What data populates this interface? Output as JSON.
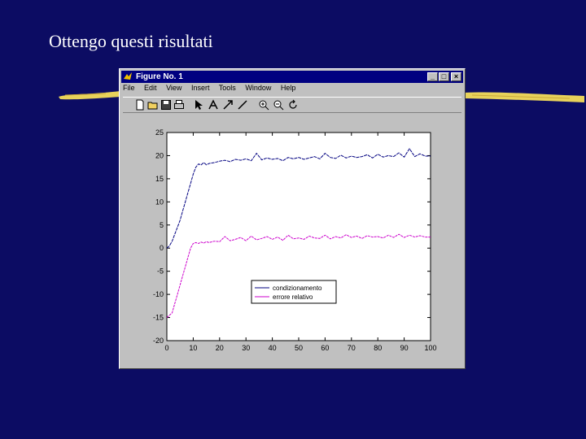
{
  "slide": {
    "title": "Ottengo questi risultati"
  },
  "window": {
    "title": "Figure No. 1",
    "controls": {
      "minimize": "_",
      "maximize": "□",
      "close": "×"
    },
    "menu": [
      "File",
      "Edit",
      "View",
      "Insert",
      "Tools",
      "Window",
      "Help"
    ],
    "tools": [
      "new-file-icon",
      "open-folder-icon",
      "save-icon",
      "print-icon",
      "pointer-icon",
      "text-tool-icon",
      "arrow-tool-icon",
      "line-tool-icon",
      "zoom-in-icon",
      "zoom-out-icon",
      "rotate-icon"
    ]
  },
  "chart_data": {
    "type": "line",
    "xlim": [
      0,
      100
    ],
    "ylim": [
      -20,
      25
    ],
    "x_ticks": [
      0,
      10,
      20,
      30,
      40,
      50,
      60,
      70,
      80,
      90,
      100
    ],
    "y_ticks": [
      25,
      20,
      15,
      10,
      5,
      0,
      -5,
      -10,
      -15,
      -20
    ],
    "legend_position": "center-right",
    "series": [
      {
        "name": "condizionamento",
        "color": "#000080",
        "dash": "solid",
        "x": [
          0,
          1,
          2,
          3,
          4,
          5,
          6,
          7,
          8,
          9,
          10,
          11,
          12,
          13,
          14,
          15,
          16,
          18,
          20,
          22,
          24,
          26,
          28,
          30,
          32,
          34,
          36,
          38,
          40,
          42,
          44,
          46,
          48,
          50,
          52,
          54,
          56,
          58,
          60,
          62,
          64,
          66,
          68,
          70,
          72,
          74,
          76,
          78,
          80,
          82,
          84,
          86,
          88,
          90,
          92,
          94,
          96,
          98,
          100
        ],
        "y": [
          0,
          0.5,
          1.5,
          3,
          4.5,
          6,
          8,
          10,
          12,
          14,
          16,
          17.5,
          18.2,
          18,
          18.5,
          18,
          18.3,
          18.5,
          18.8,
          19,
          18.7,
          19.2,
          19,
          19.3,
          18.9,
          20.5,
          19.1,
          19.5,
          19.2,
          19.4,
          18.9,
          19.6,
          19.3,
          19.6,
          19.2,
          19.5,
          19.8,
          19.3,
          20.5,
          19.6,
          19.4,
          20.1,
          19.5,
          19.9,
          19.6,
          19.8,
          20.2,
          19.5,
          20.3,
          19.7,
          20,
          19.8,
          20.6,
          19.7,
          21.5,
          19.8,
          20.4,
          19.9,
          19.9
        ]
      },
      {
        "name": "errore relativo",
        "color": "#cc00cc",
        "dash": "solid",
        "x": [
          0,
          1,
          2,
          3,
          4,
          5,
          6,
          7,
          8,
          9,
          10,
          11,
          12,
          13,
          14,
          15,
          16,
          18,
          20,
          22,
          24,
          26,
          28,
          30,
          32,
          34,
          36,
          38,
          40,
          42,
          44,
          46,
          48,
          50,
          52,
          54,
          56,
          58,
          60,
          62,
          64,
          66,
          68,
          70,
          72,
          74,
          76,
          78,
          80,
          82,
          84,
          86,
          88,
          90,
          92,
          94,
          96,
          98,
          100
        ],
        "y": [
          -15,
          -14.5,
          -14,
          -12,
          -10,
          -8,
          -6,
          -4,
          -2,
          0,
          1,
          1.2,
          1,
          1.3,
          1.1,
          1.4,
          1.2,
          1.5,
          1.4,
          2.5,
          1.6,
          1.9,
          2.3,
          1.6,
          2.6,
          1.8,
          2.1,
          2.5,
          1.9,
          2.4,
          1.7,
          2.8,
          2,
          2.2,
          1.9,
          2.6,
          2.2,
          2.1,
          2.8,
          2,
          2.5,
          2.2,
          2.9,
          2.3,
          2.6,
          2.1,
          2.7,
          2.4,
          2.5,
          2.2,
          2.8,
          2.3,
          3,
          2.3,
          2.8,
          2.4,
          2.7,
          2.4,
          2.4
        ]
      }
    ]
  }
}
